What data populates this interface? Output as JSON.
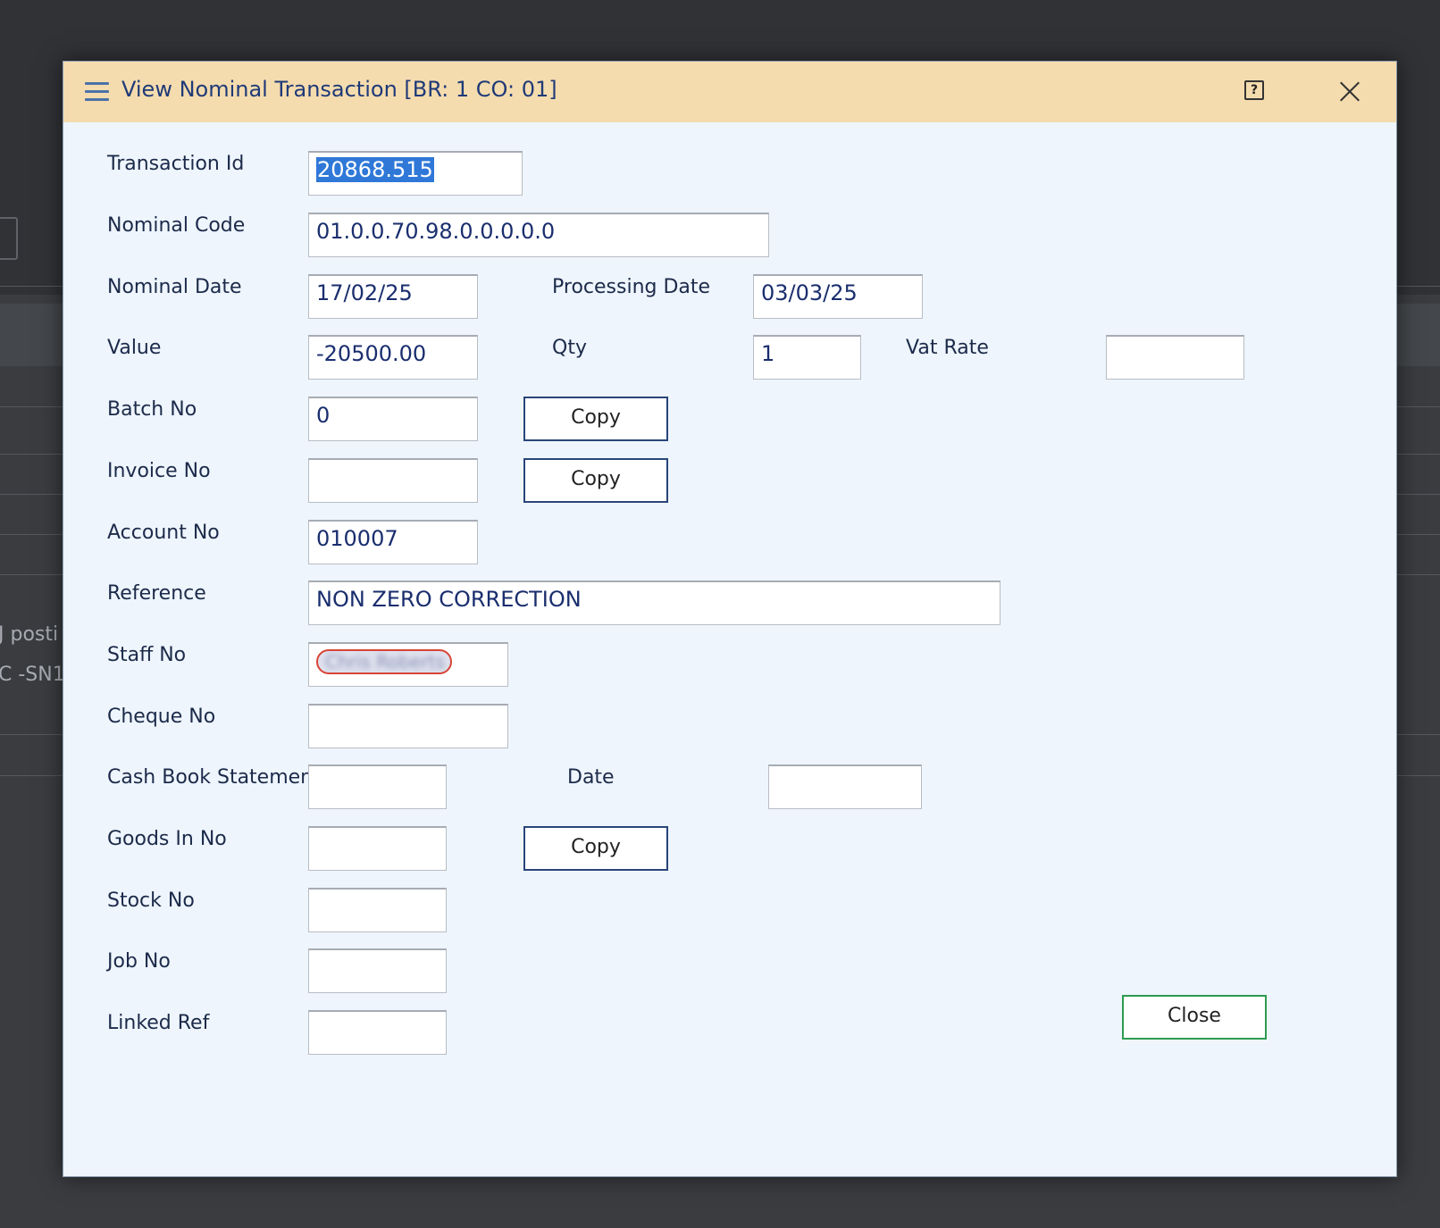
{
  "background": {
    "snippet_1": "J posti",
    "snippet_2": "C -SN1"
  },
  "dialog": {
    "title": "View Nominal Transaction [BR: 1 CO: 01]",
    "help_glyph": "?"
  },
  "form": {
    "transaction_id": {
      "label": "Transaction Id",
      "value": "20868.515"
    },
    "nominal_code": {
      "label": "Nominal Code",
      "value": "01.0.0.70.98.0.0.0.0.0"
    },
    "nominal_date": {
      "label": "Nominal Date",
      "value": "17/02/25"
    },
    "processing_date": {
      "label": "Processing Date",
      "value": "03/03/25"
    },
    "value": {
      "label": "Value",
      "value": "-20500.00"
    },
    "qty": {
      "label": "Qty",
      "value": "1"
    },
    "vat_rate": {
      "label": "Vat Rate",
      "value": ""
    },
    "batch_no": {
      "label": "Batch No",
      "value": "0"
    },
    "invoice_no": {
      "label": "Invoice No",
      "value": ""
    },
    "account_no": {
      "label": "Account No",
      "value": "010007"
    },
    "reference": {
      "label": "Reference",
      "value": "NON ZERO CORRECTION"
    },
    "staff_no": {
      "label": "Staff No",
      "value": "Chris Roberts"
    },
    "cheque_no": {
      "label": "Cheque No",
      "value": ""
    },
    "cash_book_statement": {
      "label": "Cash Book Statement",
      "value": ""
    },
    "date": {
      "label": "Date",
      "value": ""
    },
    "goods_in_no": {
      "label": "Goods In No",
      "value": ""
    },
    "stock_no": {
      "label": "Stock No",
      "value": ""
    },
    "job_no": {
      "label": "Job No",
      "value": ""
    },
    "linked_ref": {
      "label": "Linked Ref",
      "value": ""
    }
  },
  "buttons": {
    "copy_label": "Copy",
    "close_label": "Close"
  },
  "colors": {
    "titlebar": "#f5dcae",
    "dialog_body": "#eef5fc",
    "selection": "#2f78d8",
    "close_button_border": "#2d9b50"
  }
}
